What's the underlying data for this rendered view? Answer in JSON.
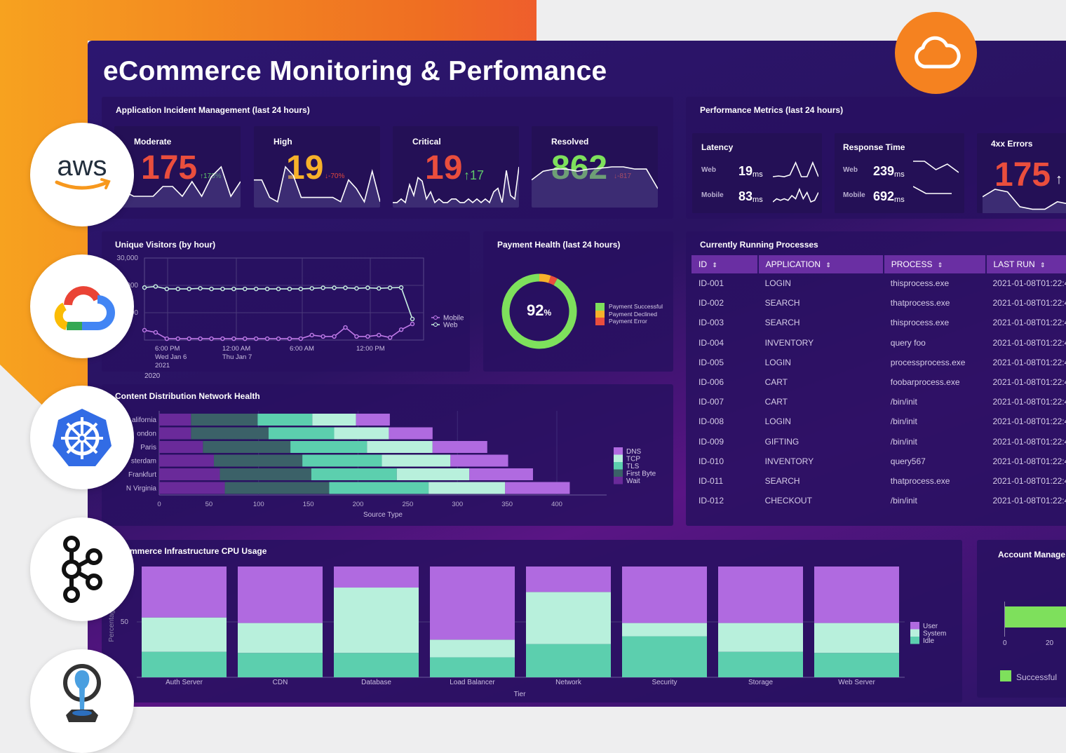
{
  "title": "eCommerce Monitoring & Perfomance",
  "incidents": {
    "title": "Application Incident Management (last 24 hours)",
    "cards": [
      {
        "label": "Moderate",
        "value": "175",
        "delta": "↑173%",
        "value_color": "#ea4e3d",
        "delta_color": "#5fc86a",
        "spark": [
          8,
          3,
          2,
          2,
          2,
          4,
          4,
          2,
          5,
          2,
          6,
          8,
          2,
          5
        ]
      },
      {
        "label": "High",
        "value": "19",
        "delta": "↓-70%",
        "value_color": "#f7b12a",
        "delta_color": "#e0473e",
        "spark": [
          6,
          6,
          2,
          1,
          9,
          7,
          2,
          2,
          2,
          2,
          2,
          1,
          6,
          4,
          1,
          8,
          1
        ]
      },
      {
        "label": "Critical",
        "value": "19",
        "delta": "↑17",
        "value_color": "#ea4e3d",
        "delta_color": "#5fc86a",
        "spark": [
          1,
          1,
          2,
          1,
          6,
          3,
          8,
          7,
          2,
          4,
          1,
          2,
          1,
          1,
          2,
          2,
          1,
          1,
          2,
          1,
          2,
          1,
          2,
          1,
          4,
          5,
          1,
          10,
          3,
          2,
          11
        ]
      },
      {
        "label": "Resolved",
        "value": "862",
        "delta": "↓-817",
        "value_color": "#7ee05c",
        "delta_color": "#e0473e",
        "spark": [
          6,
          8,
          8.5,
          8.5,
          8,
          8.5,
          8.7,
          9,
          9,
          8.5,
          8.5,
          4
        ]
      }
    ]
  },
  "performance": {
    "title": "Performance Metrics (last 24 hours)",
    "latency": {
      "label": "Latency",
      "web_label": "Web",
      "web_value": "19",
      "mobile_label": "Mobile",
      "mobile_value": "83",
      "unit": "ms",
      "web_spark": [
        1,
        1.2,
        1,
        1.5,
        5,
        1,
        1,
        5,
        1
      ],
      "mobile_spark": [
        1,
        2,
        1.5,
        2,
        1.5,
        3,
        2,
        5,
        2,
        4,
        1,
        1.5,
        4
      ]
    },
    "response": {
      "label": "Response Time",
      "web_label": "Web",
      "web_value": "239",
      "mobile_label": "Mobile",
      "mobile_value": "692",
      "unit": "ms",
      "web_spark": [
        5,
        5,
        2,
        4,
        1
      ],
      "mobile_spark": [
        4,
        2,
        2,
        2
      ]
    },
    "errors": {
      "label": "4xx Errors",
      "value": "175",
      "delta": "↑",
      "spark": [
        6,
        9,
        8,
        2,
        1,
        1,
        4,
        3,
        5,
        2
      ]
    }
  },
  "visitors": {
    "title": "Unique Visitors (by hour)",
    "y_ticks": [
      "30,000",
      "20,000",
      "10,000"
    ],
    "x_ticks": [
      [
        "6:00 PM",
        "Wed Jan 6",
        "2021"
      ],
      [
        "12:00 AM",
        "Thu Jan 7"
      ],
      [
        "6:00 AM"
      ],
      [
        "12:00 PM"
      ]
    ],
    "year_label": "2020",
    "ylim": [
      0,
      30000
    ],
    "series": [
      {
        "name": "Mobile",
        "color": "#c07ae8",
        "values": [
          3600,
          2800,
          500,
          500,
          500,
          500,
          500,
          500,
          500,
          500,
          500,
          500,
          500,
          500,
          500,
          1800,
          1300,
          1300,
          4600,
          1300,
          1300,
          1800,
          900,
          3800,
          5900
        ]
      },
      {
        "name": "Web",
        "color": "#c9f2e2",
        "values": [
          19200,
          19600,
          18700,
          18700,
          18700,
          18900,
          18700,
          18700,
          18700,
          18700,
          18700,
          18700,
          18700,
          18700,
          18700,
          18900,
          19100,
          19100,
          19100,
          18900,
          19100,
          18900,
          19100,
          19200,
          7700
        ]
      }
    ]
  },
  "payment": {
    "title": "Payment Health (last 24 hours)",
    "value": "92",
    "unit": "%",
    "slices": [
      {
        "label": "Payment Successful",
        "value": 92,
        "color": "#7ee05c"
      },
      {
        "label": "Payment Declined",
        "value": 5,
        "color": "#f7b12a"
      },
      {
        "label": "Payment Error",
        "value": 3,
        "color": "#ea4e3d"
      }
    ]
  },
  "chart_data": [
    {
      "type": "bar",
      "title": "Content Distribution Network Health",
      "orientation": "horizontal",
      "stacked": true,
      "xlabel": "Source Type",
      "xlim": [
        0,
        450
      ],
      "x_ticks": [
        "0",
        "50",
        "100",
        "150",
        "200",
        "250",
        "300",
        "350",
        "400"
      ],
      "categories": [
        "California",
        "London",
        "Paris",
        "Amsterdam",
        "Frankfurt",
        "N Virginia"
      ],
      "category_labels": [
        "alifornia",
        "ondon",
        "Paris",
        "sterdam",
        "Frankfurt",
        "N Virginia"
      ],
      "legend": "right",
      "series": [
        {
          "name": "Wait",
          "color": "#6a2a9a",
          "values": [
            32,
            32,
            44,
            55,
            61,
            66
          ]
        },
        {
          "name": "First Byte",
          "color": "#3b6168",
          "values": [
            67,
            78,
            88,
            89,
            92,
            105
          ]
        },
        {
          "name": "TLS",
          "color": "#5ccfae",
          "values": [
            55,
            66,
            77,
            80,
            86,
            100
          ]
        },
        {
          "name": "TCP",
          "color": "#b8f0dc",
          "values": [
            44,
            55,
            66,
            69,
            73,
            77
          ]
        },
        {
          "name": "DNS",
          "color": "#b06ae0",
          "values": [
            34,
            44,
            55,
            58,
            64,
            65
          ]
        }
      ],
      "legend_order": [
        "DNS",
        "TCP",
        "TLS",
        "First Byte",
        "Wait"
      ]
    },
    {
      "type": "bar",
      "title": "mmerce Infrastructure CPU Usage",
      "stacked": true,
      "xlabel": "Tier",
      "ylabel": "Percentage",
      "ylim": [
        0,
        100
      ],
      "y_ticks": [
        "50"
      ],
      "categories": [
        "Auth Server",
        "CDN",
        "Database",
        "Load Balancer",
        "Network",
        "Security",
        "Storage",
        "Web Server"
      ],
      "legend": "right",
      "series": [
        {
          "name": "Idle",
          "color": "#5ccfae",
          "values": [
            23,
            22,
            22,
            18,
            30,
            37,
            23,
            22
          ]
        },
        {
          "name": "System",
          "color": "#b8f0dc",
          "values": [
            31,
            27,
            59,
            16,
            47,
            12,
            26,
            27
          ]
        },
        {
          "name": "User",
          "color": "#b06ae0",
          "values": [
            46,
            51,
            19,
            66,
            23,
            51,
            51,
            51
          ]
        }
      ],
      "legend_order": [
        "User",
        "System",
        "Idle"
      ]
    },
    {
      "type": "bar",
      "title": "Account Manage",
      "orientation": "horizontal",
      "x_ticks": [
        "0",
        "20"
      ],
      "series": [
        {
          "name": "Successful",
          "color": "#7ee05c"
        }
      ]
    }
  ],
  "processes": {
    "title": "Currently Running Processes",
    "columns": [
      "ID",
      "APPLICATION",
      "PROCESS",
      "LAST RUN"
    ],
    "sort_icon": "⇕",
    "rows": [
      [
        "ID-001",
        "LOGIN",
        "thisprocess.exe",
        "2021-01-08T01:22:4"
      ],
      [
        "ID-002",
        "SEARCH",
        "thatprocess.exe",
        "2021-01-08T01:22:4"
      ],
      [
        "ID-003",
        "SEARCH",
        "thisprocess.exe",
        "2021-01-08T01:22:4"
      ],
      [
        "ID-004",
        "INVENTORY",
        "query foo",
        "2021-01-08T01:22:4"
      ],
      [
        "ID-005",
        "LOGIN",
        "processprocess.exe",
        "2021-01-08T01:22:4"
      ],
      [
        "ID-006",
        "CART",
        "foobarprocess.exe",
        "2021-01-08T01:22:4"
      ],
      [
        "ID-007",
        "CART",
        "/bin/init",
        "2021-01-08T01:22:4"
      ],
      [
        "ID-008",
        "LOGIN",
        "/bin/init",
        "2021-01-08T01:22:4"
      ],
      [
        "ID-009",
        "GIFTING",
        "/bin/init",
        "2021-01-08T01:22:4"
      ],
      [
        "ID-010",
        "INVENTORY",
        "query567",
        "2021-01-08T01:22:4"
      ],
      [
        "ID-011",
        "SEARCH",
        "thatprocess.exe",
        "2021-01-08T01:22:4"
      ],
      [
        "ID-012",
        "CHECKOUT",
        "/bin/init",
        "2021-01-08T01:22:4"
      ]
    ]
  },
  "logos": {
    "aws": "aws",
    "items": [
      "aws-logo",
      "google-cloud-logo",
      "kubernetes-logo",
      "kafka-logo",
      "fluentd-logo"
    ],
    "badge": "cloud-icon"
  }
}
